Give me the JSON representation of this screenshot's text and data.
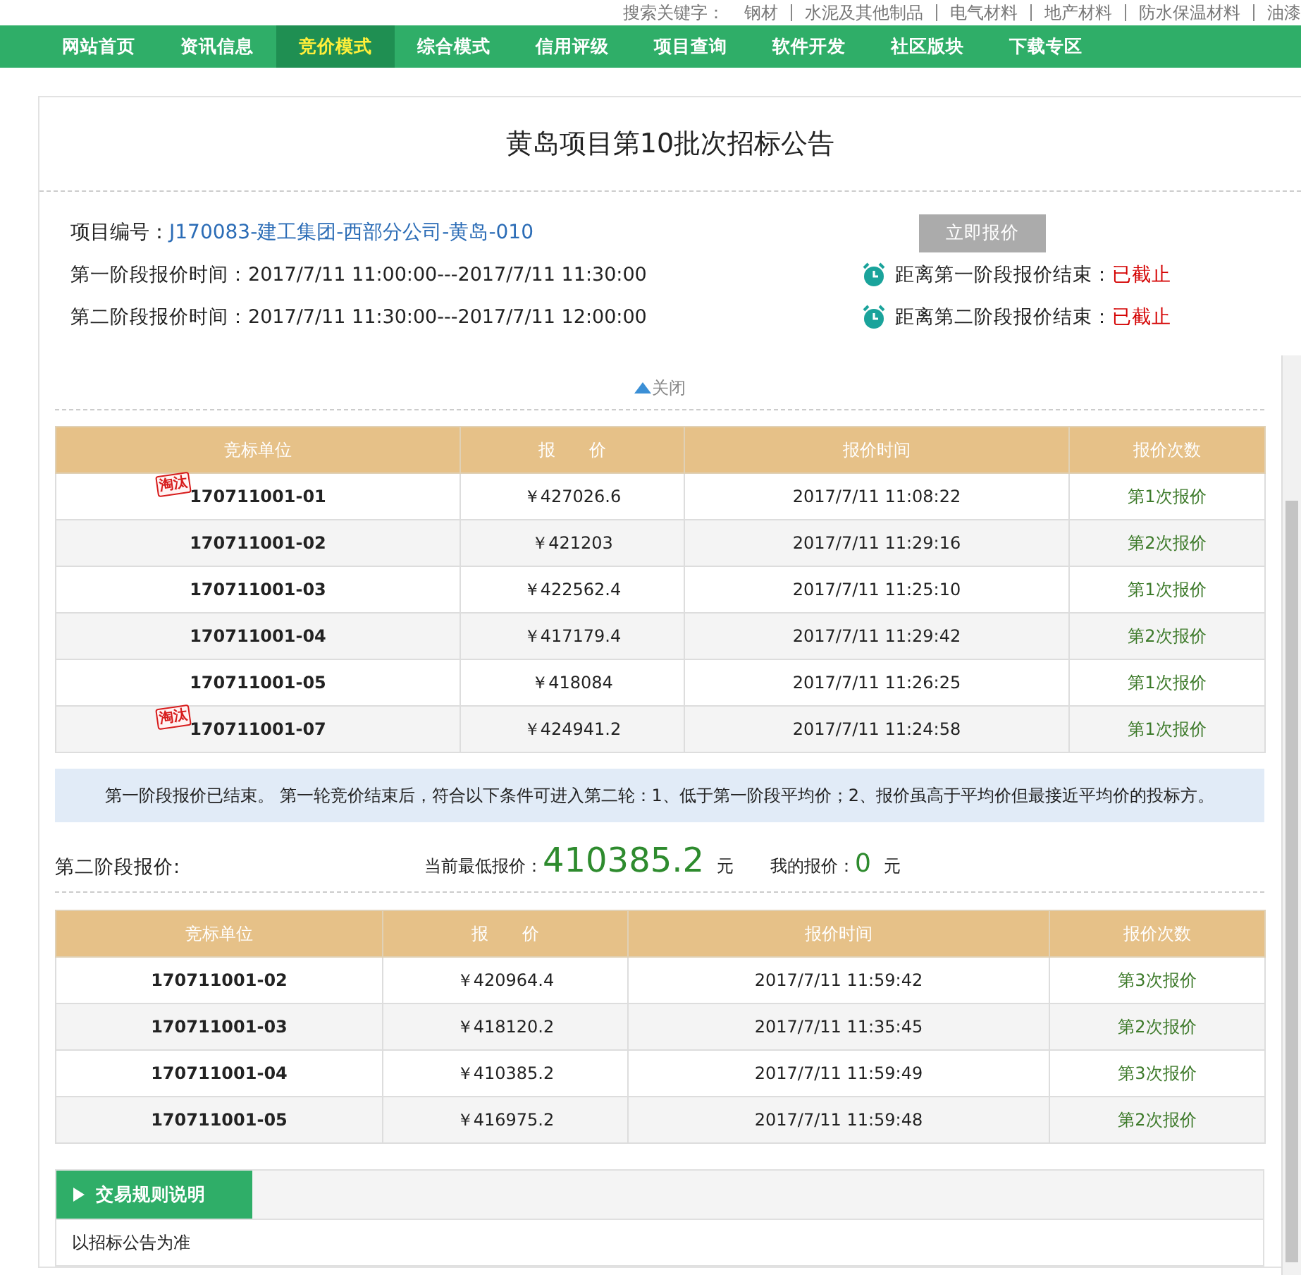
{
  "search_keywords": {
    "label": "搜索关键字：",
    "items": [
      "钢材",
      "水泥及其他制品",
      "电气材料",
      "地产材料",
      "防水保温材料",
      "油漆"
    ]
  },
  "nav": [
    {
      "label": "网站首页",
      "selected": false
    },
    {
      "label": "资讯信息",
      "selected": false
    },
    {
      "label": "竞价模式",
      "selected": true
    },
    {
      "label": "综合模式",
      "selected": false
    },
    {
      "label": "信用评级",
      "selected": false
    },
    {
      "label": "项目查询",
      "selected": false
    },
    {
      "label": "软件开发",
      "selected": false
    },
    {
      "label": "社区版块",
      "selected": false
    },
    {
      "label": "下载专区",
      "selected": false
    }
  ],
  "title": "黄岛项目第10批次招标公告",
  "project": {
    "label": "项目编号：",
    "value": "J170083-建工集团-西部分公司-黄岛-010"
  },
  "bid_button": "立即报价",
  "stages": [
    {
      "label": "第一阶段报价时间：2017/7/11 11:00:00---2017/7/11 11:30:00",
      "countdown_label": "距离第一阶段报价结束：",
      "countdown_value": "已截止"
    },
    {
      "label": "第二阶段报价时间：2017/7/11 11:30:00---2017/7/11 12:00:00",
      "countdown_label": "距离第二阶段报价结束：",
      "countdown_value": "已截止"
    }
  ],
  "toggle": {
    "label": "关闭",
    "expanded": true
  },
  "table1": {
    "columns": [
      "竞标单位",
      "报　　价",
      "报价时间",
      "报价次数"
    ],
    "rows": [
      {
        "stamp": "淘汰",
        "unit": "170711001-01",
        "price": "￥427026.6",
        "time": "2017/7/11 11:08:22",
        "count": "第1次报价"
      },
      {
        "unit": "170711001-02",
        "price": "￥421203",
        "time": "2017/7/11 11:29:16",
        "count": "第2次报价"
      },
      {
        "unit": "170711001-03",
        "price": "￥422562.4",
        "time": "2017/7/11 11:25:10",
        "count": "第1次报价"
      },
      {
        "unit": "170711001-04",
        "price": "￥417179.4",
        "time": "2017/7/11 11:29:42",
        "count": "第2次报价"
      },
      {
        "unit": "170711001-05",
        "price": "￥418084",
        "time": "2017/7/11 11:26:25",
        "count": "第1次报价"
      },
      {
        "stamp": "淘汰",
        "unit": "170711001-07",
        "price": "￥424941.2",
        "time": "2017/7/11 11:24:58",
        "count": "第1次报价"
      }
    ]
  },
  "notice": "第一阶段报价已结束。 第一轮竞价结束后，符合以下条件可进入第二轮：1、低于第一阶段平均价；2、报价虽高于平均价但最接近平均价的投标方。",
  "stage2": {
    "label": "第二阶段报价:",
    "lowest_label": "当前最低报价：",
    "lowest_value": "410385.2",
    "lowest_unit": "元",
    "mine_label": "我的报价：",
    "mine_value": "0",
    "mine_unit": "元"
  },
  "table2": {
    "columns": [
      "竞标单位",
      "报　　价",
      "报价时间",
      "报价次数"
    ],
    "rows": [
      {
        "unit": "170711001-02",
        "price": "￥420964.4",
        "time": "2017/7/11 11:59:42",
        "count": "第3次报价"
      },
      {
        "unit": "170711001-03",
        "price": "￥418120.2",
        "time": "2017/7/11 11:35:45",
        "count": "第2次报价"
      },
      {
        "unit": "170711001-04",
        "price": "￥410385.2",
        "time": "2017/7/11 11:59:49",
        "count": "第3次报价"
      },
      {
        "unit": "170711001-05",
        "price": "￥416975.2",
        "time": "2017/7/11 11:59:48",
        "count": "第2次报价"
      }
    ]
  },
  "rules": {
    "tab": "交易规则说明",
    "body": "以招标公告为准"
  }
}
